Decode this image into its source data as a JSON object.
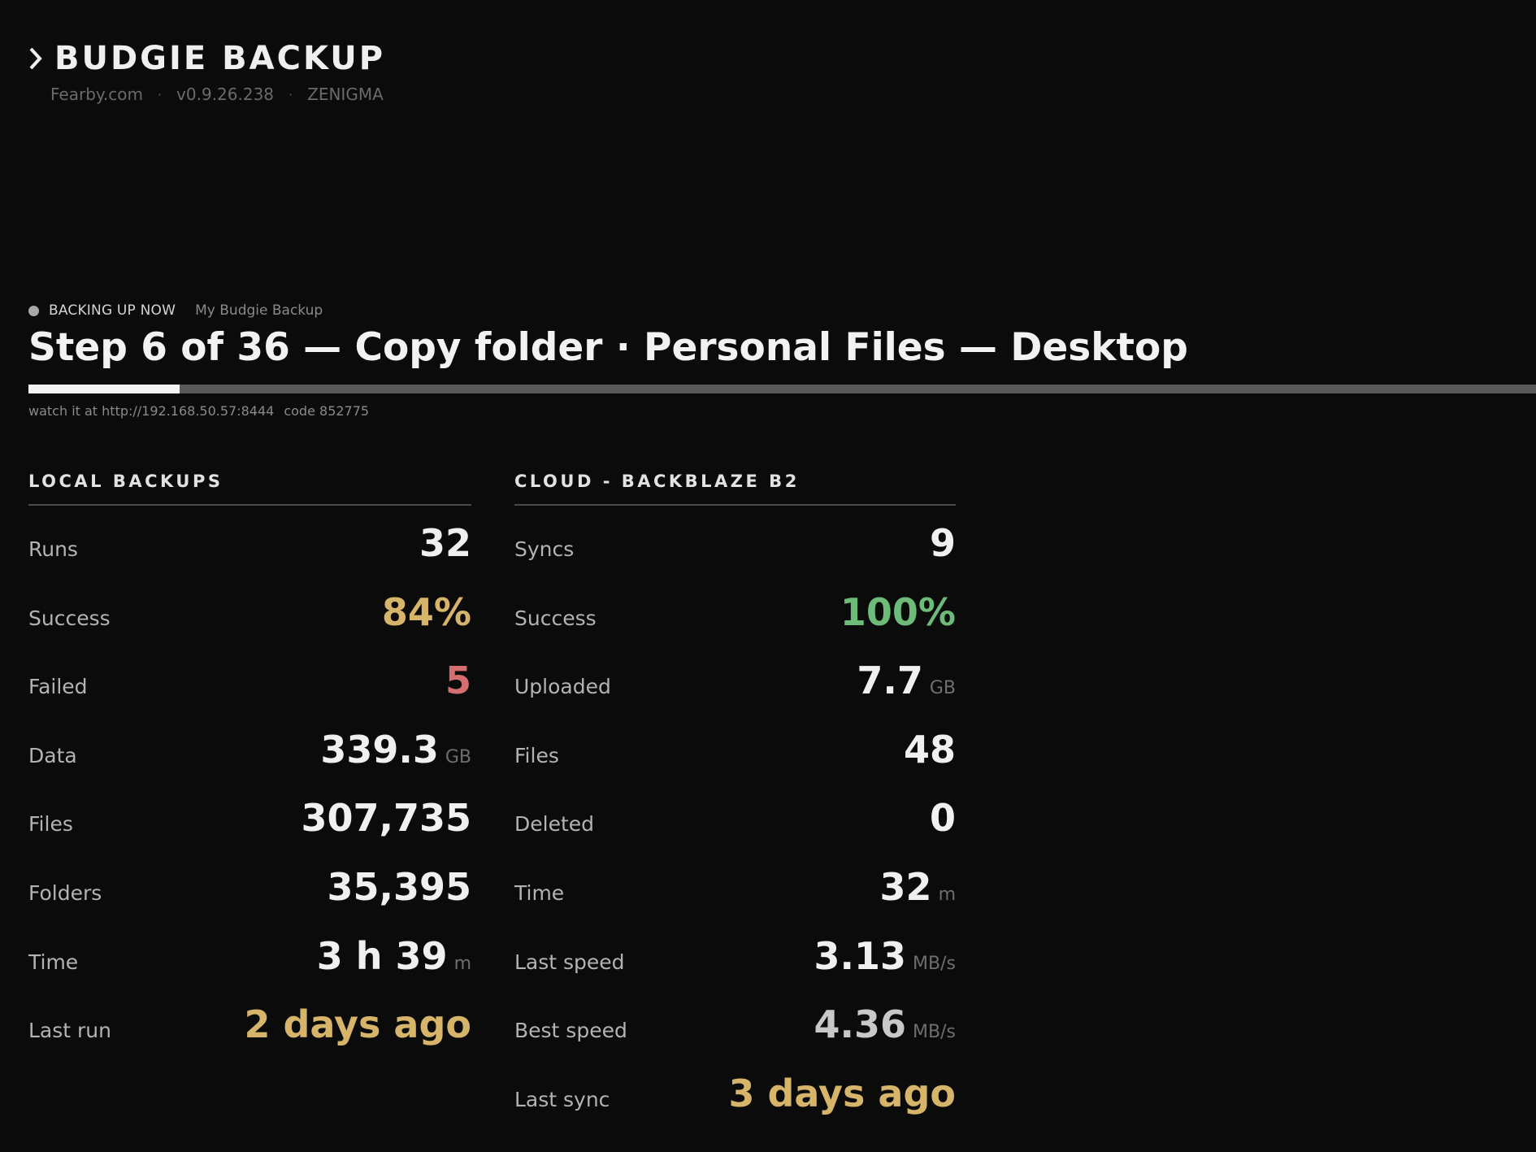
{
  "app": {
    "title": "BUDGIE BACKUP",
    "site": "Fearby.com",
    "version": "v0.9.26.238",
    "host": "ZENIGMA",
    "separator": "·"
  },
  "status": {
    "state": "BACKING UP NOW",
    "job_name": "My Budgie Backup",
    "step_title": "Step 6 of 36 — Copy folder · Personal Files — Desktop",
    "progress_fraction": 0.1,
    "watch_url_text": "watch it at http://192.168.50.57:8444",
    "code_text": "code 852775"
  },
  "local": {
    "heading": "LOCAL BACKUPS",
    "rows": [
      {
        "label": "Runs",
        "value": "32",
        "unit": "",
        "color": "default"
      },
      {
        "label": "Success",
        "value": "84%",
        "unit": "",
        "color": "gold"
      },
      {
        "label": "Failed",
        "value": "5",
        "unit": "",
        "color": "red"
      },
      {
        "label": "Data",
        "value": "339.3",
        "unit": "GB",
        "color": "default"
      },
      {
        "label": "Files",
        "value": "307,735",
        "unit": "",
        "color": "default"
      },
      {
        "label": "Folders",
        "value": "35,395",
        "unit": "",
        "color": "default"
      },
      {
        "label": "Time",
        "value": "3 h 39",
        "unit": "m",
        "color": "default"
      },
      {
        "label": "Last run",
        "value": "2 days ago",
        "unit": "",
        "color": "gold"
      }
    ]
  },
  "cloud": {
    "heading": "CLOUD - BACKBLAZE B2",
    "rows": [
      {
        "label": "Syncs",
        "value": "9",
        "unit": "",
        "color": "default"
      },
      {
        "label": "Success",
        "value": "100%",
        "unit": "",
        "color": "green"
      },
      {
        "label": "Uploaded",
        "value": "7.7",
        "unit": "GB",
        "color": "default"
      },
      {
        "label": "Files",
        "value": "48",
        "unit": "",
        "color": "default"
      },
      {
        "label": "Deleted",
        "value": "0",
        "unit": "",
        "color": "default"
      },
      {
        "label": "Time",
        "value": "32",
        "unit": "m",
        "color": "default"
      },
      {
        "label": "Last speed",
        "value": "3.13",
        "unit": "MB/s",
        "color": "default"
      },
      {
        "label": "Best speed",
        "value": "4.36",
        "unit": "MB/s",
        "color": "dim"
      },
      {
        "label": "Last sync",
        "value": "3 days ago",
        "unit": "",
        "color": "gold"
      }
    ]
  },
  "colors": {
    "background": "#0b0b0b",
    "gold": "#d6b46a",
    "red": "#d56f6f",
    "green": "#6dbb78"
  }
}
